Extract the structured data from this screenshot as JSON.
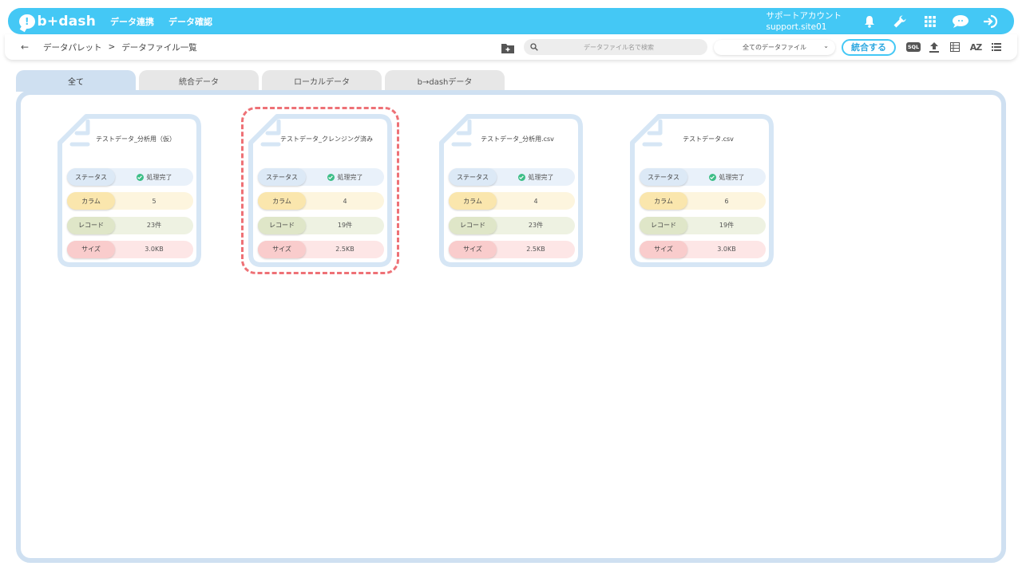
{
  "header": {
    "logo_text": "b+dash",
    "nav": [
      "データ連携",
      "データ確認"
    ],
    "account_line1": "サポートアカウント",
    "account_line2": "support.site01",
    "icons": [
      "bell-icon",
      "wrench-icon",
      "grid-icon",
      "chat-icon",
      "logout-icon"
    ],
    "brand_color": "#44c8f5"
  },
  "toolbar": {
    "back": "←",
    "breadcrumb": [
      "データパレット",
      "データファイル一覧"
    ],
    "breadcrumb_sep": ">",
    "search_placeholder": "データファイル名で検索",
    "filter_value": "全てのデータファイル",
    "merge_label": "統合する",
    "sql_label": "SQL",
    "az_label": "AZ"
  },
  "tabs": [
    {
      "label": "全て",
      "active": true
    },
    {
      "label": "統合データ",
      "active": false
    },
    {
      "label": "ローカルデータ",
      "active": false
    },
    {
      "label": "b→dashデータ",
      "active": false
    }
  ],
  "field_labels": {
    "status": "ステータス",
    "column": "カラム",
    "record": "レコード",
    "size": "サイズ"
  },
  "cards": [
    {
      "name": "テストデータ_分析用（仮）",
      "status": "処理完了",
      "columns": "5",
      "records": "23件",
      "size": "3.0KB",
      "selected": false
    },
    {
      "name": "テストデータ_クレンジング済み",
      "status": "処理完了",
      "columns": "4",
      "records": "19件",
      "size": "2.5KB",
      "selected": true
    },
    {
      "name": "テストデータ_分析用.csv",
      "status": "処理完了",
      "columns": "4",
      "records": "23件",
      "size": "2.5KB",
      "selected": false
    },
    {
      "name": "テストデータ.csv",
      "status": "処理完了",
      "columns": "6",
      "records": "19件",
      "size": "3.0KB",
      "selected": false
    }
  ]
}
